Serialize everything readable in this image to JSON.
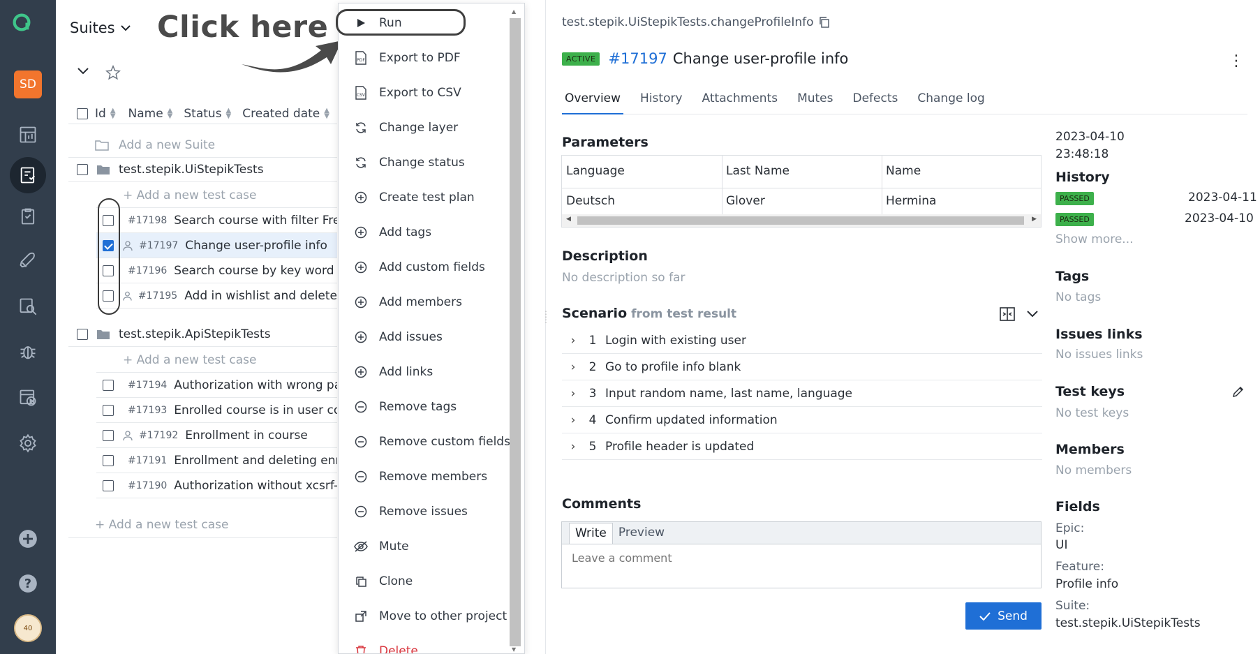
{
  "rail": {
    "user_initials": "SD",
    "avatar_label": "40",
    "items": [
      "dashboard-icon",
      "test-cases-icon",
      "test-plans-icon",
      "launches-icon",
      "analytics-icon",
      "defects-icon",
      "jobs-icon",
      "settings-icon"
    ]
  },
  "suites": {
    "title": "Suites",
    "callout": "Click here",
    "columns": {
      "id": "Id",
      "name": "Name",
      "status": "Status",
      "created": "Created date"
    },
    "add_suite": "Add a new Suite",
    "add_test_case": "+ Add a new test case",
    "add_test_case_bottom": "+ Add a new test case",
    "groups": [
      {
        "name": "test.stepik.UiStepikTests",
        "cases": [
          {
            "id": "#17198",
            "name": "Search course with filter Free",
            "checked": false
          },
          {
            "id": "#17197",
            "name": "Change user-profile info",
            "checked": true
          },
          {
            "id": "#17196",
            "name": "Search course by key word and",
            "checked": false
          },
          {
            "id": "#17195",
            "name": "Add in wishlist and delete",
            "checked": false
          }
        ]
      },
      {
        "name": "test.stepik.ApiStepikTests",
        "cases": [
          {
            "id": "#17194",
            "name": "Authorization with wrong password",
            "checked": false
          },
          {
            "id": "#17193",
            "name": "Enrolled course is in user course",
            "checked": false
          },
          {
            "id": "#17192",
            "name": "Enrollment in course",
            "checked": false
          },
          {
            "id": "#17191",
            "name": "Enrollment and deleting enrollment",
            "checked": false
          },
          {
            "id": "#17190",
            "name": "Authorization without xcsrf-token",
            "checked": false
          }
        ]
      }
    ]
  },
  "menu": {
    "items": [
      {
        "label": "Run",
        "icon": "play-icon"
      },
      {
        "label": "Export to PDF",
        "icon": "pdf-icon"
      },
      {
        "label": "Export to CSV",
        "icon": "csv-icon"
      },
      {
        "label": "Change layer",
        "icon": "refresh-icon"
      },
      {
        "label": "Change status",
        "icon": "refresh-icon"
      },
      {
        "label": "Create test plan",
        "icon": "plus-circle-icon"
      },
      {
        "label": "Add tags",
        "icon": "plus-circle-icon"
      },
      {
        "label": "Add custom fields",
        "icon": "plus-circle-icon"
      },
      {
        "label": "Add members",
        "icon": "plus-circle-icon"
      },
      {
        "label": "Add issues",
        "icon": "plus-circle-icon"
      },
      {
        "label": "Add links",
        "icon": "plus-circle-icon"
      },
      {
        "label": "Remove tags",
        "icon": "minus-circle-icon"
      },
      {
        "label": "Remove custom fields",
        "icon": "minus-circle-icon"
      },
      {
        "label": "Remove members",
        "icon": "minus-circle-icon"
      },
      {
        "label": "Remove issues",
        "icon": "minus-circle-icon"
      },
      {
        "label": "Mute",
        "icon": "eye-off-icon"
      },
      {
        "label": "Clone",
        "icon": "clone-icon"
      },
      {
        "label": "Move to other project",
        "icon": "move-icon"
      },
      {
        "label": "Delete",
        "icon": "trash-icon"
      }
    ]
  },
  "detail": {
    "breadcrumb": "test.stepik.UiStepikTests.changeProfileInfo",
    "status_badge": "ACTIVE",
    "id": "#17197",
    "name": "Change user-profile info",
    "tabs": [
      "Overview",
      "History",
      "Attachments",
      "Mutes",
      "Defects",
      "Change log"
    ],
    "parameters": {
      "title": "Parameters",
      "headers": [
        "Language",
        "Last Name",
        "Name"
      ],
      "values": [
        "Deutsch",
        "Glover",
        "Hermina"
      ]
    },
    "description": {
      "title": "Description",
      "text": "No description so far"
    },
    "scenario": {
      "title": "Scenario",
      "source": "from test result",
      "steps": [
        {
          "n": "1",
          "text": "Login with existing user"
        },
        {
          "n": "2",
          "text": "Go to profile info blank"
        },
        {
          "n": "3",
          "text": "Input random name, last name, language"
        },
        {
          "n": "4",
          "text": "Confirm updated information"
        },
        {
          "n": "5",
          "text": "Profile header is updated"
        }
      ]
    },
    "comments": {
      "title": "Comments",
      "tab_write": "Write",
      "tab_preview": "Preview",
      "placeholder": "Leave a comment",
      "send": "Send"
    }
  },
  "sidebar": {
    "created_date": "2023-04-10",
    "created_time": "23:48:18",
    "history_title": "History",
    "history": [
      {
        "status": "PASSED",
        "date": "2023-04-11"
      },
      {
        "status": "PASSED",
        "date": "2023-04-10"
      }
    ],
    "show_more": "Show more...",
    "tags_title": "Tags",
    "tags_empty": "No tags",
    "issues_title": "Issues links",
    "issues_empty": "No issues links",
    "keys_title": "Test keys",
    "keys_empty": "No test keys",
    "members_title": "Members",
    "members_empty": "No members",
    "fields_title": "Fields",
    "fields": [
      {
        "label": "Epic:",
        "value": "UI"
      },
      {
        "label": "Feature:",
        "value": "Profile info"
      },
      {
        "label": "Suite:",
        "value": "test.stepik.UiStepikTests"
      }
    ]
  },
  "colors": {
    "rail": "#323e4c",
    "accent": "#1f6fd6",
    "passed": "#3db04b",
    "danger": "#d9363e",
    "brand_orange": "#f2752d"
  }
}
